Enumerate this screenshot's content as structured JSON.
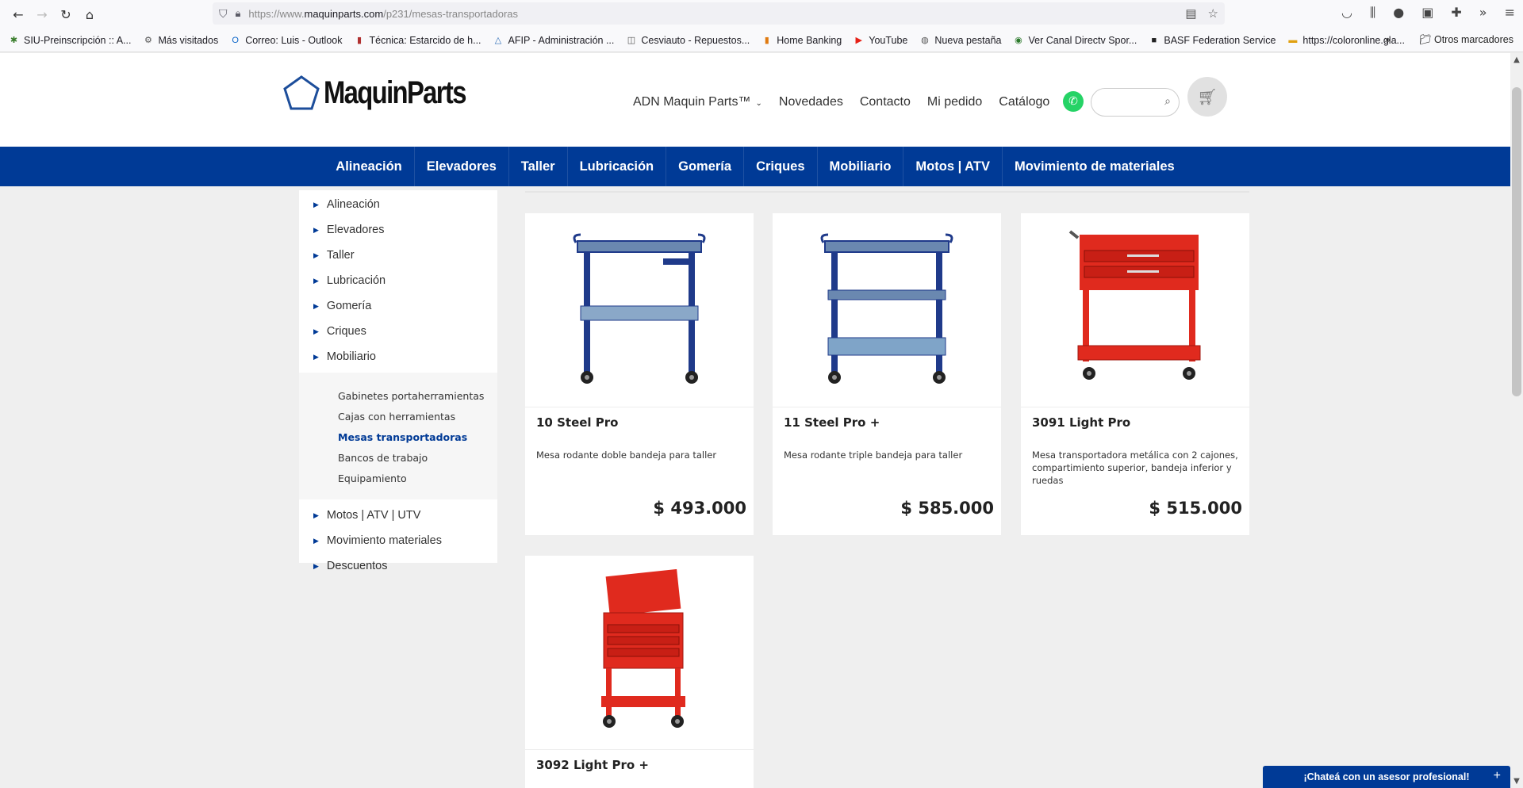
{
  "browser": {
    "url_prefix": "https://www.",
    "url_domain": "maquinparts.com",
    "url_path": "/p231/mesas-transportadoras",
    "bookmarks": [
      {
        "label": "SIU-Preinscripción :: A...",
        "icon": "star-icon",
        "color": "#3a7d2c"
      },
      {
        "label": "Más visitados",
        "icon": "gear-icon",
        "color": "#555555"
      },
      {
        "label": "Correo: Luis - Outlook",
        "icon": "outlook-icon",
        "color": "#0a64c8"
      },
      {
        "label": "Técnica: Estarcido de h...",
        "icon": "book-icon",
        "color": "#b03030"
      },
      {
        "label": "AFIP - Administración ...",
        "icon": "triangle-icon",
        "color": "#2a6ab5"
      },
      {
        "label": "Cesviauto - Repuestos...",
        "icon": "bag-icon",
        "color": "#555555"
      },
      {
        "label": "Home Banking",
        "icon": "bank-icon",
        "color": "#e07a10"
      },
      {
        "label": "YouTube",
        "icon": "youtube-icon",
        "color": "#e62117"
      },
      {
        "label": "Nueva pestaña",
        "icon": "globe-icon",
        "color": "#555555"
      },
      {
        "label": "Ver Canal Directv Spor...",
        "icon": "ball-icon",
        "color": "#2c7a2c"
      },
      {
        "label": "BASF Federation Service",
        "icon": "basf-icon",
        "color": "#222222"
      },
      {
        "label": "https://coloronline.gla...",
        "icon": "paint-icon",
        "color": "#e0a010"
      }
    ],
    "bookmarks_right": {
      "more": "»",
      "other": "Otros marcadores"
    }
  },
  "site": {
    "logo_text": "MaquinParts",
    "top_menu": [
      {
        "label": "ADN Maquin Parts™",
        "has_dropdown": true
      },
      {
        "label": "Novedades"
      },
      {
        "label": "Contacto"
      },
      {
        "label": "Mi pedido"
      },
      {
        "label": "Catálogo"
      }
    ],
    "search_placeholder": "",
    "categories": [
      "Alineación",
      "Elevadores",
      "Taller",
      "Lubricación",
      "Gomería",
      "Criques",
      "Mobiliario",
      "Motos | ATV",
      "Movimiento de materiales"
    ],
    "brand_color": "#003a96"
  },
  "sidebar": {
    "items_top": [
      "Alineación",
      "Elevadores",
      "Taller",
      "Lubricación",
      "Gomería",
      "Criques",
      "Mobiliario"
    ],
    "submenu": [
      {
        "label": "Gabinetes portaherramientas",
        "active": false
      },
      {
        "label": "Cajas con herramientas",
        "active": false
      },
      {
        "label": "Mesas transportadoras",
        "active": true
      },
      {
        "label": "Bancos de trabajo",
        "active": false
      },
      {
        "label": "Equipamiento",
        "active": false
      }
    ],
    "items_bottom": [
      "Motos | ATV | UTV",
      "Movimiento materiales",
      "Descuentos"
    ]
  },
  "products": [
    {
      "name": "10 Steel Pro",
      "desc": "Mesa rodante doble bandeja para taller",
      "price": "$ 493.000",
      "color": "#1f3a8a",
      "style": "double"
    },
    {
      "name": "11 Steel Pro +",
      "desc": "Mesa rodante triple bandeja para taller",
      "price": "$ 585.000",
      "color": "#1f3a8a",
      "style": "triple"
    },
    {
      "name": "3091 Light Pro",
      "desc": "Mesa transportadora metálica con 2 cajones, compartimiento superior, bandeja inferior y ruedas",
      "price": "$ 515.000",
      "color": "#e02a1e",
      "style": "drawer"
    },
    {
      "name": "3092 Light Pro +",
      "desc": "",
      "price": "",
      "color": "#e02a1e",
      "style": "tall"
    }
  ],
  "chat": {
    "label": "¡Chateá con un asesor profesional!",
    "plus": "+"
  }
}
